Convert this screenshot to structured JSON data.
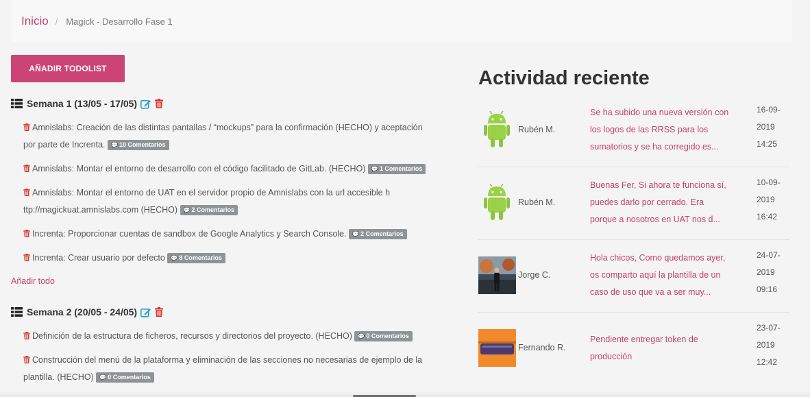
{
  "breadcrumb": {
    "home": "Inicio",
    "separator": "/",
    "current": "Magick - Desarrollo Fase 1"
  },
  "add_todolist_label": "AÑADIR TODOLIST",
  "weeks": [
    {
      "title": "Semana 1 (13/05 - 17/05)",
      "tasks": [
        {
          "line1": "Amnislabs: Creación de las distintas pantallas / “mockups” para la confirmación (HECHO) y aceptación",
          "line2": "por parte de Increnta.",
          "comments": "10 Comentarios"
        },
        {
          "line1": "Amnislabs: Montar el entorno de desarrollo con el código facilitado de GitLab. (HECHO)",
          "comments": "1 Comentarios"
        },
        {
          "line1": "Amnislabs: Montar el entorno de UAT en el servidor propio de Amnislabs con la url accesible h",
          "line2": "ttp://magickuat.amnislabs.com (HECHO)",
          "comments": "2 Comentarios"
        },
        {
          "line1": "Increnta: Proporcionar cuentas de sandbox de Google Analytics y Search Console.",
          "comments": "2 Comentarios"
        },
        {
          "line1": "Increnta: Crear usuario por defecto",
          "comments": "8 Comentarios"
        }
      ],
      "add_all_label": "Añadir todo"
    },
    {
      "title": "Semana 2 (20/05 - 24/05)",
      "tasks": [
        {
          "line1": "Definición de la estructura de ficheros, recursos y directorios del proyecto. (HECHO)",
          "comments": "0 Comentarios"
        },
        {
          "line1": "Construcción del menú de la plataforma y eliminación de las secciones no necesarias de ejemplo de la",
          "line2": "plantilla. (HECHO)",
          "comments": "0 Comentarios"
        }
      ]
    }
  ],
  "activity": {
    "title": "Actividad reciente",
    "items": [
      {
        "user": "Rubén M.",
        "avatar": "android-avatar",
        "msg1": "Se ha subido una nueva versión con",
        "msg2": "los logos de las RRSS para los",
        "msg3": "sumatorios y se ha corregido es...",
        "date": "16-09-",
        "year": "2019",
        "time": "14:25"
      },
      {
        "user": "Rubén M.",
        "avatar": "android-avatar",
        "msg1": "Buenas Fer, Si ahora te funciona sí,",
        "msg2": "puedes darlo por cerrado. Era",
        "msg3": "porque a nosotros en UAT nos d...",
        "date": "10-09-",
        "year": "2019",
        "time": "16:42"
      },
      {
        "user": "Jorge C.",
        "avatar": "photo-avatar",
        "msg1": "Hola chicos, Como quedamos ayer,",
        "msg2": "os comparto aquí la plantilla de un",
        "msg3": "caso de uso que va a ser muy...",
        "date": "24-07-",
        "year": "2019",
        "time": "09:16"
      },
      {
        "user": "Fernando R.",
        "avatar": "orange-avatar",
        "msg1": "Pendiente entregar token de",
        "msg2": "producción",
        "msg3": "",
        "date": "23-07-",
        "year": "2019",
        "time": "12:42"
      }
    ]
  },
  "colors": {
    "accent": "#cb4474",
    "link": "#c43f6f",
    "edit": "#1e9fd8",
    "trash": "#d9342b",
    "badge": "#8f9395"
  }
}
